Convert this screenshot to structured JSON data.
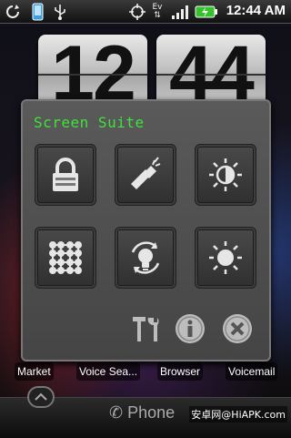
{
  "status_bar": {
    "time": "12:44 AM",
    "icons": [
      "sync-icon",
      "phone-icon",
      "usb-icon",
      "gps-icon",
      "data-ev-icon",
      "signal-icon",
      "battery-charging-icon"
    ]
  },
  "clock_widget": {
    "hour": "12",
    "minute": "44"
  },
  "screen_suite": {
    "title": "Screen Suite",
    "tiles": [
      {
        "icon": "lock-icon"
      },
      {
        "icon": "flashlight-icon"
      },
      {
        "icon": "brightness-half-icon"
      },
      {
        "icon": "pattern-grid-icon"
      },
      {
        "icon": "bulb-rotate-icon"
      },
      {
        "icon": "brightness-full-icon"
      }
    ],
    "tools": [
      {
        "icon": "tools-icon"
      },
      {
        "icon": "info-icon"
      },
      {
        "icon": "close-icon"
      }
    ]
  },
  "shortcuts": [
    {
      "label": "Market"
    },
    {
      "label": "Voice Sea..."
    },
    {
      "label": "Browser"
    },
    {
      "label": "Voicemail"
    }
  ],
  "dock": {
    "phone_label": "Phone"
  },
  "watermark": "安卓网@HiAPK.com",
  "colors": {
    "title_green": "#3fe33a",
    "panel_bg": "#4f4f4f"
  }
}
